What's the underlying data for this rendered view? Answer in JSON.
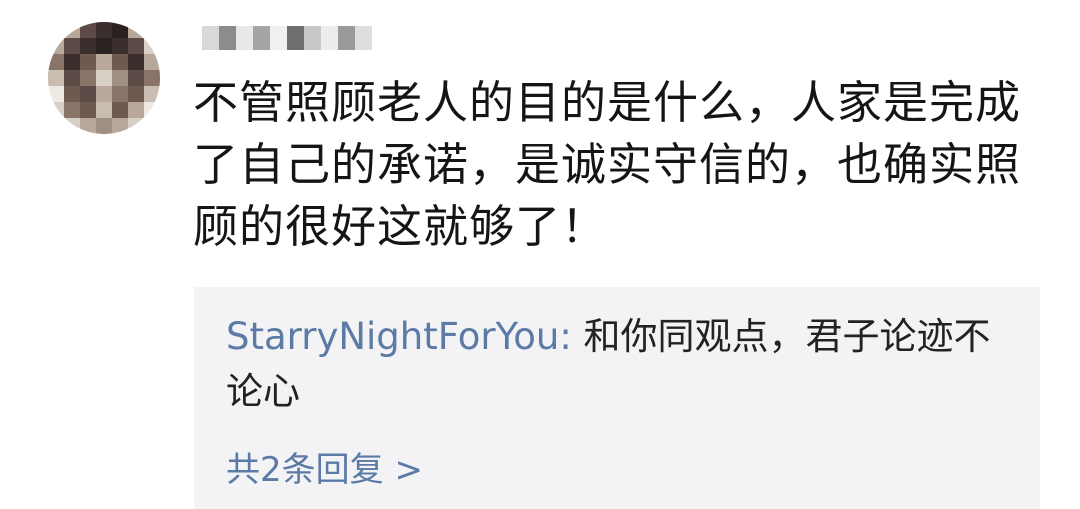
{
  "comment": {
    "text": "不管照顾老人的目的是什么，人家是完成了自己的承诺，是诚实守信的，也确实照顾的很好这就够了！"
  },
  "reply": {
    "author": "StarryNightForYou:",
    "text": " 和你同观点，君子论迹不论心",
    "more_label": "共2条回复 >"
  },
  "colors": {
    "link": "#5b7aa6",
    "reply_bg": "#f3f3f5",
    "text": "#151515"
  }
}
